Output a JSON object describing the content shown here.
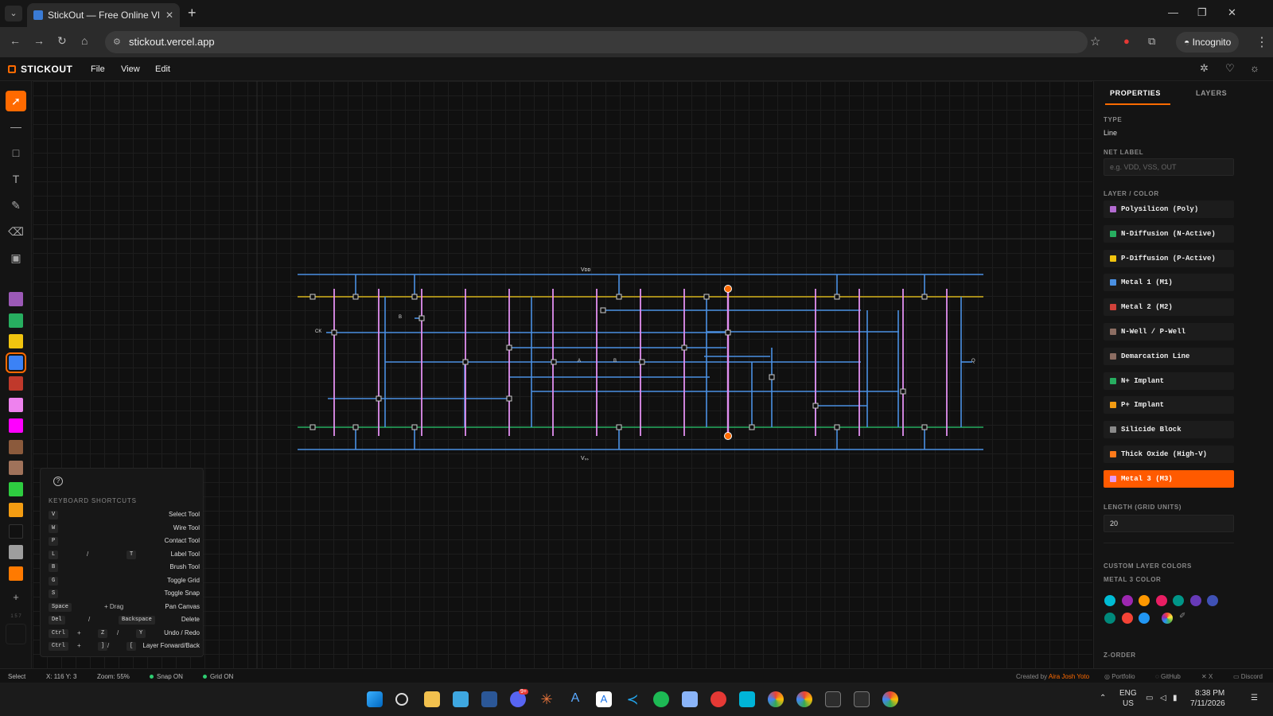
{
  "browser": {
    "tab_title": "StickOut — Free Online VLSI St",
    "tab_close": "✕",
    "new_tab": "+",
    "url": "stickout.vercel.app",
    "incognito_label": "Incognito"
  },
  "app": {
    "brand": "STICKOUT",
    "menu": [
      "File",
      "View",
      "Edit"
    ]
  },
  "toolbar": {
    "tools": [
      "select-tool",
      "wire-tool",
      "rect-tool",
      "label-tool",
      "brush-tool",
      "eraser-tool",
      "image-tool"
    ],
    "swatches": [
      "#9b59b6",
      "#27ae60",
      "#f1c40f",
      "#3b82f6",
      "#c0392b",
      "#ee82ee",
      "#ff00ff",
      "#8b5a3c",
      "#a0725a",
      "#2ecc40",
      "#f39c12",
      "#111111",
      "#9e9e9e",
      "#ff7a00"
    ],
    "selected_swatch_index": 3,
    "add_label": "+",
    "extra_label": "1 5 7"
  },
  "canvas": {
    "vdd_label": "Vᴅᴅ",
    "vss_label": "Vₛₛ",
    "pin_labels": {
      "clk": "CK",
      "b1": "B",
      "a": "A",
      "b2": "B",
      "q": "Q"
    }
  },
  "shortcuts": {
    "title": "KEYBOARD SHORTCUTS",
    "rows": [
      {
        "keys": [
          "V"
        ],
        "action": "Select Tool"
      },
      {
        "keys": [
          "W"
        ],
        "action": "Wire Tool"
      },
      {
        "keys": [
          "P"
        ],
        "action": "Contact Tool"
      },
      {
        "keys": [
          "L",
          "/",
          "T"
        ],
        "action": "Label Tool"
      },
      {
        "keys": [
          "B"
        ],
        "action": "Brush Tool"
      },
      {
        "keys": [
          "G"
        ],
        "action": "Toggle Grid"
      },
      {
        "keys": [
          "S"
        ],
        "action": "Toggle Snap"
      },
      {
        "keys": [
          "Space",
          "+ Drag"
        ],
        "action": "Pan Canvas"
      },
      {
        "keys": [
          "Del",
          "/",
          "Backspace"
        ],
        "action": "Delete"
      },
      {
        "keys": [
          "Ctrl",
          "+",
          "Z",
          "/",
          "Y"
        ],
        "action": "Undo / Redo"
      },
      {
        "keys": [
          "Ctrl",
          "+",
          "]",
          "/",
          "["
        ],
        "action": "Layer Forward/Back"
      }
    ]
  },
  "properties": {
    "tabs": [
      "PROPERTIES",
      "LAYERS"
    ],
    "type_label": "TYPE",
    "type_value": "Line",
    "net_label": "NET LABEL",
    "net_placeholder": "e.g. VDD, VSS, OUT",
    "layer_label": "LAYER / COLOR",
    "layers": [
      {
        "name": "Polysilicon (Poly)",
        "color": "#b36bd1"
      },
      {
        "name": "N-Diffusion (N-Active)",
        "color": "#27ae60"
      },
      {
        "name": "P-Diffusion (P-Active)",
        "color": "#f1c40f"
      },
      {
        "name": "Metal 1 (M1)",
        "color": "#4a90e2"
      },
      {
        "name": "Metal 2 (M2)",
        "color": "#d0413a"
      },
      {
        "name": "N-Well / P-Well",
        "color": "#8d6e63"
      },
      {
        "name": "Demarcation Line",
        "color": "#8d6e63"
      },
      {
        "name": "N+ Implant",
        "color": "#27ae60"
      },
      {
        "name": "P+ Implant",
        "color": "#f39c12"
      },
      {
        "name": "Silicide Block",
        "color": "#8a8a8a"
      },
      {
        "name": "Thick Oxide (High-V)",
        "color": "#ff7a1a"
      },
      {
        "name": "Metal 3 (M3)",
        "color": "#e59bf0"
      }
    ],
    "selected_layer_index": 11,
    "length_label": "LENGTH (GRID UNITS)",
    "length_value": "20",
    "custom_label": "CUSTOM LAYER COLORS",
    "metal3_label": "METAL 3 COLOR",
    "custom_colors": [
      "#00bcd4",
      "#9c27b0",
      "#ff9800",
      "#e91e63",
      "#009688",
      "#673ab7",
      "#3f51b5",
      "#00897b",
      "#f44336",
      "#2196f3"
    ],
    "zorder_label": "Z-ORDER"
  },
  "status": {
    "mode": "Select",
    "coords": "X: 116  Y: 3",
    "zoom": "Zoom: 55%",
    "snap": "Snap ON",
    "grid": "Grid ON",
    "credit_prefix": "Created by",
    "credit_name": "Aira Josh Yoto",
    "links": [
      "Portfolio",
      "GitHub",
      "X",
      "Discord"
    ]
  },
  "taskbar": {
    "lang": "ENG",
    "region": "US",
    "time": "8:38 PM",
    "date": "7/11/2026",
    "badge": "9+"
  }
}
